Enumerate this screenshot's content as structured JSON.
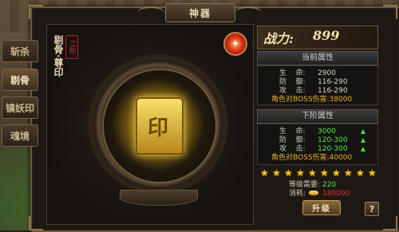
{
  "window": {
    "title": "神器"
  },
  "tabs": [
    {
      "label": "斩杀",
      "active": false
    },
    {
      "label": "剔骨",
      "active": true
    },
    {
      "label": "镇妖印",
      "active": false
    },
    {
      "label": "魂境",
      "active": false
    }
  ],
  "artifact": {
    "name": "剔骨·尊印",
    "grade": "二阶",
    "seal_char": "印"
  },
  "power": {
    "label": "战力:",
    "value": "899"
  },
  "current": {
    "heading": "当前属性",
    "stats": [
      {
        "label": "生    命:",
        "value": "2900"
      },
      {
        "label": "防    御:",
        "value": "116-290"
      },
      {
        "label": "攻    击:",
        "value": "116-290"
      }
    ],
    "boss": "角色对BOSS伤害:38000"
  },
  "next": {
    "heading": "下阶属性",
    "stats": [
      {
        "label": "生    命:",
        "value": "3000"
      },
      {
        "label": "防    御:",
        "value": "120-300"
      },
      {
        "label": "攻    击:",
        "value": "120-300"
      }
    ],
    "boss": "角色对BOSS伤害:40000"
  },
  "stars": {
    "filled": 10,
    "total": 10
  },
  "requirements": {
    "level_label": "等级需要:",
    "level_value": "220",
    "cost_label": "消耗:",
    "cost_value": "180000"
  },
  "buttons": {
    "upgrade": "升级",
    "help": "?"
  },
  "colors": {
    "accent_gold": "#f5c427",
    "stat_green": "#5bea3c",
    "boss_orange": "#e6b32a",
    "cost_red": "#e0352c"
  }
}
